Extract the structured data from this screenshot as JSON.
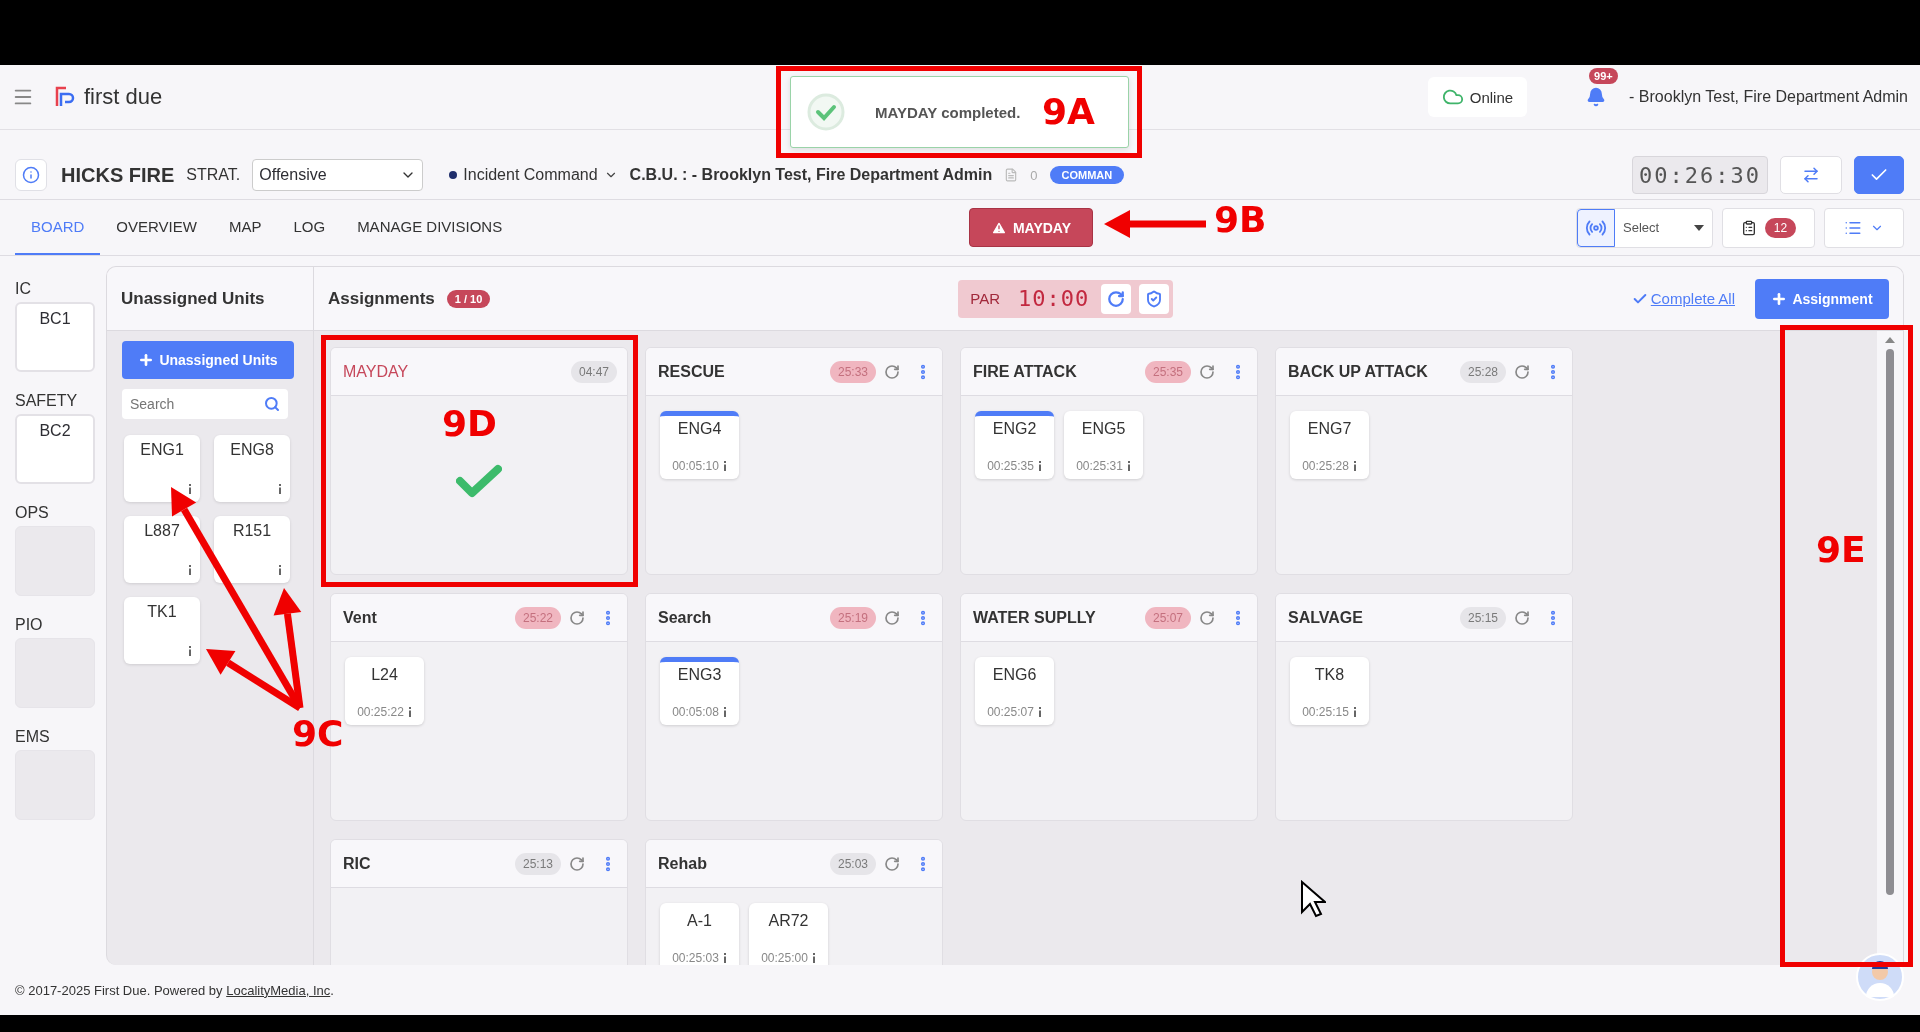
{
  "app": {
    "logo_text": "first due"
  },
  "header": {
    "connection": "Online",
    "notifications_badge": "99+",
    "user": "- Brooklyn Test, Fire Department Admin"
  },
  "toast": {
    "message": "MAYDAY completed."
  },
  "incident": {
    "name": "HICKS FIRE",
    "strategy_label": "STRAT.",
    "strategy": "Offensive",
    "command": "Incident Command",
    "cbu": "C.B.U. : - Brooklyn Test, Fire Department Admin",
    "doc_count": "0",
    "mode_badge": "COMMAN",
    "clock": "00:26:30"
  },
  "tabs": [
    {
      "label": "BOARD",
      "selected": true
    },
    {
      "label": "OVERVIEW",
      "selected": false
    },
    {
      "label": "MAP",
      "selected": false
    },
    {
      "label": "LOG",
      "selected": false
    },
    {
      "label": "MANAGE DIVISIONS",
      "selected": false
    }
  ],
  "mayday_button": "MAYDAY",
  "toolbar": {
    "radio_select": "Select",
    "tasks_badge": "12"
  },
  "roles": [
    {
      "label": "IC",
      "unit": "BC1"
    },
    {
      "label": "SAFETY",
      "unit": "BC2"
    },
    {
      "label": "OPS"
    },
    {
      "label": "PIO"
    },
    {
      "label": "EMS"
    }
  ],
  "unassigned": {
    "title": "Unassigned Units",
    "add_button": "Unassigned Units",
    "search_placeholder": "Search",
    "units": [
      "ENG1",
      "ENG8",
      "L887",
      "R151",
      "TK1"
    ]
  },
  "assignments": {
    "title": "Assignments",
    "count": "1 / 10",
    "par_label": "PAR",
    "par_timer": "10:00",
    "complete_all": "Complete All",
    "add_button": "Assignment",
    "groups": [
      {
        "kind": "mayday",
        "name": "MAYDAY",
        "timer": "04:47",
        "alert": false
      },
      {
        "kind": "group",
        "name": "RESCUE",
        "timer": "25:33",
        "alert": true,
        "units": [
          {
            "name": "ENG4",
            "time": "00:05:10",
            "highlighted": true
          }
        ]
      },
      {
        "kind": "group",
        "name": "FIRE ATTACK",
        "timer": "25:35",
        "alert": true,
        "units": [
          {
            "name": "ENG2",
            "time": "00:25:35",
            "highlighted": true
          },
          {
            "name": "ENG5",
            "time": "00:25:31",
            "highlighted": false
          }
        ]
      },
      {
        "kind": "group",
        "name": "BACK UP ATTACK",
        "timer": "25:28",
        "alert": false,
        "units": [
          {
            "name": "ENG7",
            "time": "00:25:28",
            "highlighted": false
          }
        ]
      },
      {
        "kind": "group",
        "name": "Vent",
        "timer": "25:22",
        "alert": true,
        "units": [
          {
            "name": "L24",
            "time": "00:25:22",
            "highlighted": false
          }
        ]
      },
      {
        "kind": "group",
        "name": "Search",
        "timer": "25:19",
        "alert": true,
        "units": [
          {
            "name": "ENG3",
            "time": "00:05:08",
            "highlighted": true
          }
        ]
      },
      {
        "kind": "group",
        "name": "WATER SUPLLY",
        "timer": "25:07",
        "alert": true,
        "units": [
          {
            "name": "ENG6",
            "time": "00:25:07",
            "highlighted": false
          }
        ]
      },
      {
        "kind": "group",
        "name": "SALVAGE",
        "timer": "25:15",
        "alert": false,
        "units": [
          {
            "name": "TK8",
            "time": "00:25:15",
            "highlighted": false
          }
        ]
      },
      {
        "kind": "group",
        "name": "RIC",
        "timer": "25:13",
        "alert": false
      },
      {
        "kind": "group",
        "name": "Rehab",
        "timer": "25:03",
        "alert": false,
        "units": [
          {
            "name": "A-1",
            "time": "00:25:03",
            "highlighted": false
          },
          {
            "name": "AR72",
            "time": "00:25:00",
            "highlighted": false
          }
        ]
      }
    ]
  },
  "footer": {
    "text": "© 2017-2025 First Due. Powered by ",
    "link": "LocalityMedia, Inc",
    "end": "."
  },
  "annotations": [
    {
      "label": "9A"
    },
    {
      "label": "9B"
    },
    {
      "label": "9C"
    },
    {
      "label": "9D"
    },
    {
      "label": "9E"
    }
  ]
}
